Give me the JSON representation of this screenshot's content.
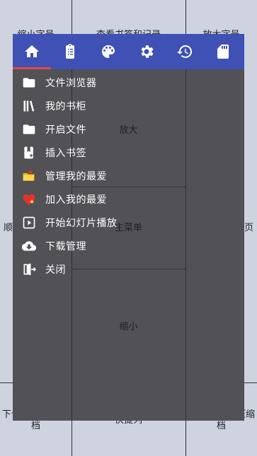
{
  "zones": {
    "top_left": "缩小字号",
    "top_center": "查看书签和记录",
    "top_right": "放大字号",
    "upper_center": "放大",
    "left": "顺向卷动并换页",
    "center": "主菜单",
    "right": "逆向卷动并换页",
    "lower_center": "缩小",
    "bottom_left": "下个文件夹/压缩档",
    "bottom_center": "快捷列",
    "bottom_right": "上个文件夹/压缩档"
  },
  "toolbar": {
    "tabs": [
      {
        "icon": "home-icon",
        "selected": true
      },
      {
        "icon": "clipboard-list-icon",
        "selected": false
      },
      {
        "icon": "palette-icon",
        "selected": false
      },
      {
        "icon": "gear-icon",
        "selected": false
      },
      {
        "icon": "history-icon",
        "selected": false
      },
      {
        "icon": "sd-card-icon",
        "selected": false
      }
    ],
    "accent_color": "#3f51b5",
    "selected_underline_color": "#e24a4a"
  },
  "menu": {
    "items": [
      {
        "label": "文件浏览器",
        "icon": "folder-icon"
      },
      {
        "label": "我的书柜",
        "icon": "bookshelf-icon"
      },
      {
        "label": "开启文件",
        "icon": "folder-open-icon"
      },
      {
        "label": "插入书签",
        "icon": "bookmark-add-icon"
      },
      {
        "label": "管理我的最爱",
        "icon": "favorites-folder-icon"
      },
      {
        "label": "加入我的最爱",
        "icon": "heart-add-icon"
      },
      {
        "label": "开始幻灯片播放",
        "icon": "slideshow-icon"
      },
      {
        "label": "下载管理",
        "icon": "cloud-download-icon"
      },
      {
        "label": "关闭",
        "icon": "exit-icon"
      }
    ]
  }
}
